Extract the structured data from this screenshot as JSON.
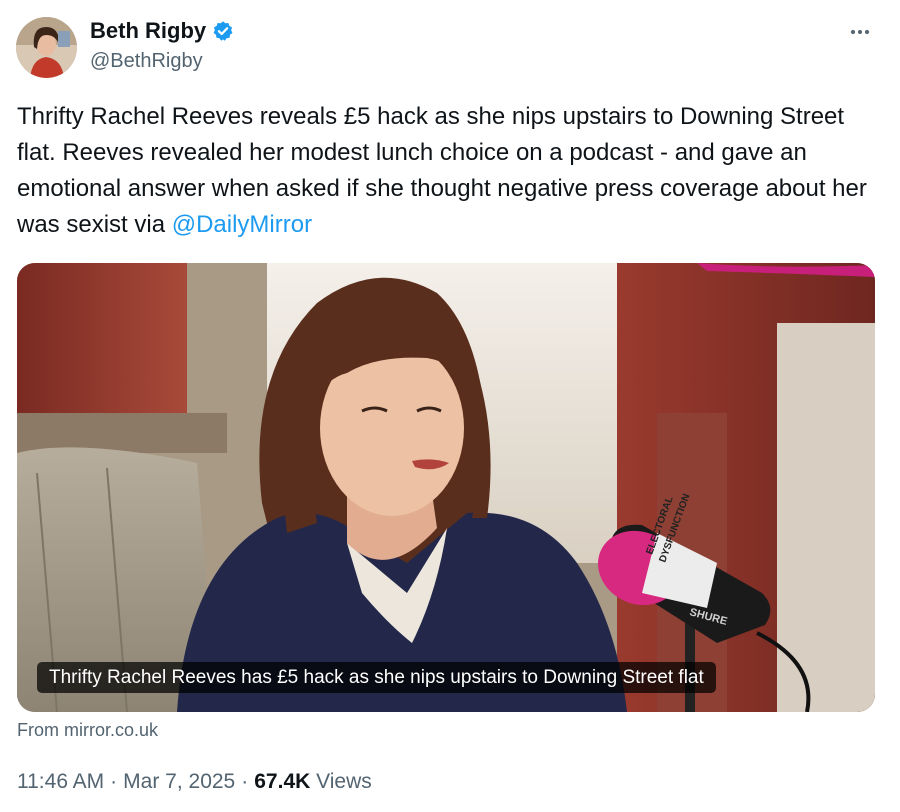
{
  "author": {
    "display_name": "Beth Rigby",
    "handle": "@BethRigby",
    "verified": true
  },
  "tweet": {
    "text_before_mention": "Thrifty Rachel Reeves reveals £5 hack as she nips upstairs to Downing Street flat. Reeves revealed her modest lunch choice on a podcast - and gave an emotional answer when asked if she thought negative press coverage about her was sexist via ",
    "mention": "@DailyMirror"
  },
  "card": {
    "caption": "Thrifty Rachel Reeves has £5 hack as she nips upstairs to Downing Street flat",
    "mic_text_1": "ELECTORAL",
    "mic_text_2": "DYSFUNCTION",
    "mic_brand": "SHURE"
  },
  "source": {
    "label": "From mirror.co.uk"
  },
  "meta": {
    "time": "11:46 AM",
    "date": "Mar 7, 2025",
    "views_count": "67.4K",
    "views_label": "Views"
  },
  "colors": {
    "link": "#1d9bf0",
    "verified_badge": "#1d9bf0",
    "secondary_text": "#536471"
  },
  "icons": {
    "verified": "verified-badge-icon",
    "more": "more-options-icon"
  }
}
